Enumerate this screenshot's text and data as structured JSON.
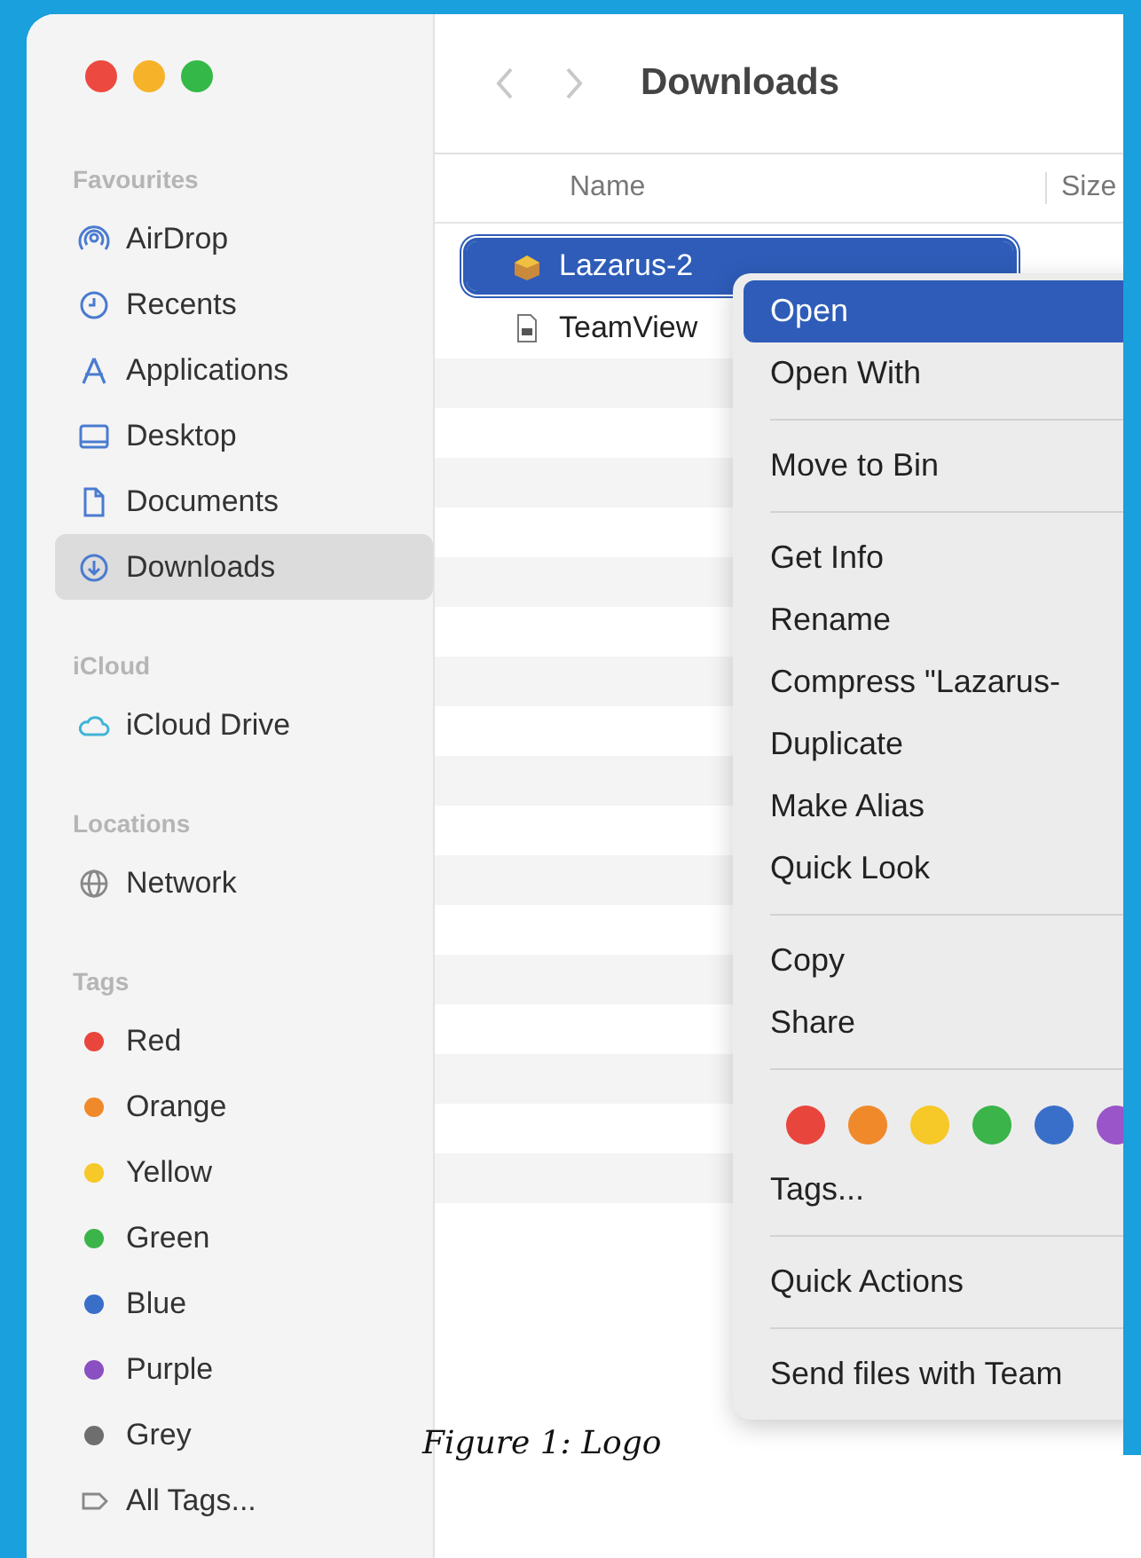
{
  "toolbar": {
    "title": "Downloads"
  },
  "sidebar": {
    "sections": [
      {
        "heading": "Favourites",
        "items": [
          {
            "label": "AirDrop",
            "kind": "airdrop",
            "selected": false
          },
          {
            "label": "Recents",
            "kind": "clock",
            "selected": false
          },
          {
            "label": "Applications",
            "kind": "apps",
            "selected": false
          },
          {
            "label": "Desktop",
            "kind": "desktop",
            "selected": false
          },
          {
            "label": "Documents",
            "kind": "document",
            "selected": false
          },
          {
            "label": "Downloads",
            "kind": "download",
            "selected": true
          }
        ]
      },
      {
        "heading": "iCloud",
        "items": [
          {
            "label": "iCloud Drive",
            "kind": "cloud",
            "selected": false
          }
        ]
      },
      {
        "heading": "Locations",
        "items": [
          {
            "label": "Network",
            "kind": "globe",
            "selected": false
          }
        ]
      },
      {
        "heading": "Tags",
        "items": [
          {
            "label": "Red",
            "kind": "tag",
            "color": "#e8453c",
            "selected": false
          },
          {
            "label": "Orange",
            "kind": "tag",
            "color": "#f0892a",
            "selected": false
          },
          {
            "label": "Yellow",
            "kind": "tag",
            "color": "#f6c828",
            "selected": false
          },
          {
            "label": "Green",
            "kind": "tag",
            "color": "#3bb44a",
            "selected": false
          },
          {
            "label": "Blue",
            "kind": "tag",
            "color": "#3a6fc9",
            "selected": false
          },
          {
            "label": "Purple",
            "kind": "tag",
            "color": "#8a4fc0",
            "selected": false
          },
          {
            "label": "Grey",
            "kind": "tag",
            "color": "#6e6e6e",
            "selected": false
          },
          {
            "label": "All Tags...",
            "kind": "alltags",
            "selected": false
          }
        ]
      }
    ]
  },
  "file_list": {
    "columns": [
      "Name",
      "Size"
    ],
    "rows": [
      {
        "name": "Lazarus-2",
        "kind": "package",
        "selected": true
      },
      {
        "name": "TeamView",
        "kind": "document",
        "selected": false
      }
    ]
  },
  "context_menu": {
    "items": [
      {
        "kind": "item",
        "label": "Open",
        "selected": true
      },
      {
        "kind": "item",
        "label": "Open With",
        "selected": false
      },
      {
        "kind": "separator"
      },
      {
        "kind": "item",
        "label": "Move to Bin",
        "selected": false
      },
      {
        "kind": "separator"
      },
      {
        "kind": "item",
        "label": "Get Info",
        "selected": false
      },
      {
        "kind": "item",
        "label": "Rename",
        "selected": false
      },
      {
        "kind": "item",
        "label": "Compress \"Lazarus-",
        "selected": false
      },
      {
        "kind": "item",
        "label": "Duplicate",
        "selected": false
      },
      {
        "kind": "item",
        "label": "Make Alias",
        "selected": false
      },
      {
        "kind": "item",
        "label": "Quick Look",
        "selected": false
      },
      {
        "kind": "separator"
      },
      {
        "kind": "item",
        "label": "Copy",
        "selected": false
      },
      {
        "kind": "item",
        "label": "Share",
        "selected": false
      },
      {
        "kind": "separator"
      },
      {
        "kind": "colors",
        "colors": [
          {
            "color": "#e8453c"
          },
          {
            "color": "#f0892a"
          },
          {
            "color": "#f6c828"
          },
          {
            "color": "#3bb44a"
          },
          {
            "color": "#3a6fc9"
          },
          {
            "color": "#9a55c8"
          }
        ]
      },
      {
        "kind": "item",
        "label": "Tags...",
        "selected": false
      },
      {
        "kind": "separator"
      },
      {
        "kind": "item",
        "label": "Quick Actions",
        "selected": false
      },
      {
        "kind": "separator"
      },
      {
        "kind": "item",
        "label": "Send files with Team",
        "selected": false
      }
    ]
  },
  "caption": "Figure 1: Logo"
}
